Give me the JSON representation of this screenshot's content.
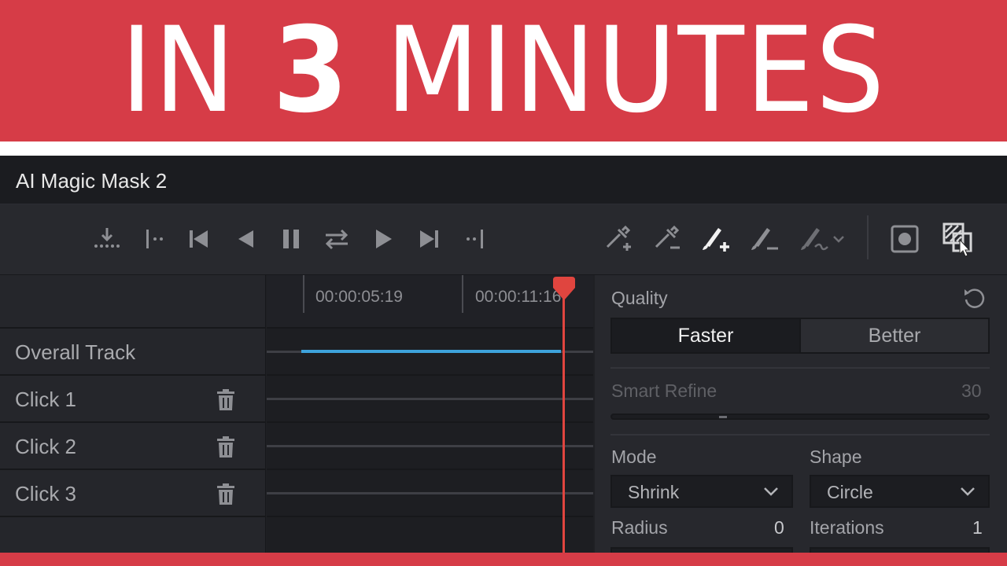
{
  "banner": {
    "prefix": "IN ",
    "number": "3",
    "suffix": " MINUTES",
    "color": "#d63c47"
  },
  "window": {
    "title": "AI Magic Mask 2"
  },
  "toolbar": {
    "buttons": [
      {
        "icon": "download-dots-icon"
      },
      {
        "icon": "track-reverse-frame-icon"
      },
      {
        "icon": "skip-to-start-icon"
      },
      {
        "icon": "play-reverse-icon"
      },
      {
        "icon": "pause-icon"
      },
      {
        "icon": "bidirectional-track-icon"
      },
      {
        "icon": "play-forward-icon"
      },
      {
        "icon": "skip-to-end-icon"
      },
      {
        "icon": "track-forward-frame-icon"
      },
      {
        "icon": "eyedropper-add-icon"
      },
      {
        "icon": "eyedropper-remove-icon"
      },
      {
        "icon": "brush-add-icon"
      },
      {
        "icon": "brush-remove-icon"
      },
      {
        "icon": "brush-menu-icon"
      },
      {
        "icon": "mask-overlay-icon"
      },
      {
        "icon": "mask-view-toggle-icon"
      }
    ]
  },
  "tracks": {
    "items": [
      {
        "label": "Overall Track"
      },
      {
        "label": "Click 1"
      },
      {
        "label": "Click 2"
      },
      {
        "label": "Click 3"
      }
    ]
  },
  "timeline": {
    "timecodes": [
      "00:00:05:19",
      "00:00:11:16"
    ],
    "accent": "#3ea3dc",
    "playhead_color": "#e0453f"
  },
  "inspector": {
    "quality_label": "Quality",
    "quality_options": [
      "Faster",
      "Better"
    ],
    "quality_selected": "Faster",
    "smart_refine_label": "Smart Refine",
    "smart_refine_value": "30",
    "mode_label": "Mode",
    "mode_value": "Shrink",
    "shape_label": "Shape",
    "shape_value": "Circle",
    "radius_label": "Radius",
    "radius_value": "0",
    "iterations_label": "Iterations",
    "iterations_value": "1"
  }
}
